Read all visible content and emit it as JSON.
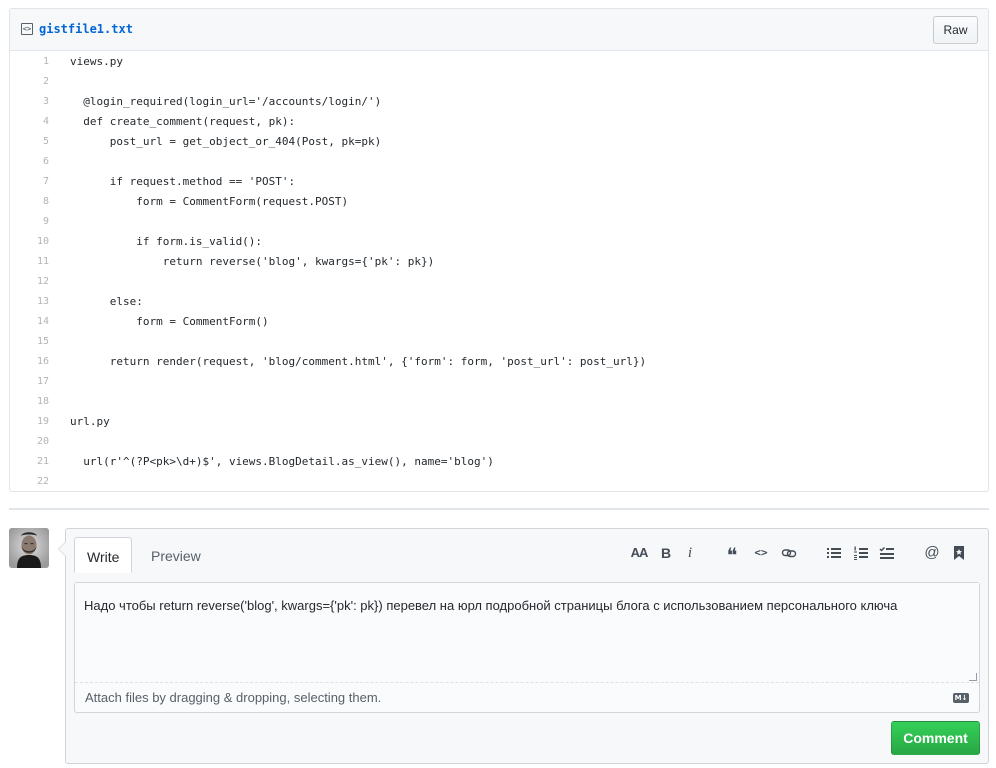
{
  "file": {
    "name": "gistfile1.txt",
    "raw_label": "Raw",
    "lines": [
      {
        "n": "1",
        "code": "views.py"
      },
      {
        "n": "2",
        "code": ""
      },
      {
        "n": "3",
        "code": "  @login_required(login_url='/accounts/login/')"
      },
      {
        "n": "4",
        "code": "  def create_comment(request, pk):"
      },
      {
        "n": "5",
        "code": "      post_url = get_object_or_404(Post, pk=pk)"
      },
      {
        "n": "6",
        "code": ""
      },
      {
        "n": "7",
        "code": "      if request.method == 'POST':"
      },
      {
        "n": "8",
        "code": "          form = CommentForm(request.POST)"
      },
      {
        "n": "9",
        "code": ""
      },
      {
        "n": "10",
        "code": "          if form.is_valid():"
      },
      {
        "n": "11",
        "code": "              return reverse('blog', kwargs={'pk': pk})"
      },
      {
        "n": "12",
        "code": ""
      },
      {
        "n": "13",
        "code": "      else:"
      },
      {
        "n": "14",
        "code": "          form = CommentForm()"
      },
      {
        "n": "15",
        "code": ""
      },
      {
        "n": "16",
        "code": "      return render(request, 'blog/comment.html', {'form': form, 'post_url': post_url})"
      },
      {
        "n": "17",
        "code": ""
      },
      {
        "n": "18",
        "code": ""
      },
      {
        "n": "19",
        "code": "url.py"
      },
      {
        "n": "20",
        "code": ""
      },
      {
        "n": "21",
        "code": "  url(r'^(?P<pk>\\d+)$', views.BlogDetail.as_view(), name='blog')"
      },
      {
        "n": "22",
        "code": ""
      }
    ]
  },
  "comment": {
    "tabs": {
      "write": "Write",
      "preview": "Preview"
    },
    "toolbar": {
      "heading": "AA",
      "bold": "B",
      "italic": "i",
      "quote": "❝",
      "code": "<>",
      "mention": "@"
    },
    "text": "Надо чтобы return reverse('blog', kwargs={'pk': pk}) перевел на юрл подробной страницы блога с использованием персонального ключа",
    "attach_text": "Attach files by dragging & dropping, selecting them.",
    "markdown_badge": "M↓",
    "submit_label": "Comment"
  },
  "colors": {
    "link": "#0366d6",
    "submit_green": "#28a745",
    "border": "#e1e4e8"
  }
}
